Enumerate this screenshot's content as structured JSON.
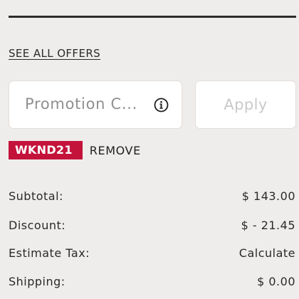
{
  "offers": {
    "link_label": "SEE ALL OFFERS"
  },
  "promo": {
    "placeholder": "Promotion C...",
    "info_icon": "info-circle-icon",
    "apply_label": "Apply"
  },
  "applied_code": {
    "code": "WKND21",
    "remove_label": "REMOVE",
    "badge_color": "#c4133b"
  },
  "summary": {
    "rows": [
      {
        "label": "Subtotal:",
        "value": "$ 143.00"
      },
      {
        "label": "Discount:",
        "value": "$ - 21.45"
      },
      {
        "label": "Estimate Tax:",
        "value": "Calculate"
      },
      {
        "label": "Shipping:",
        "value": "$ 0.00"
      }
    ]
  }
}
